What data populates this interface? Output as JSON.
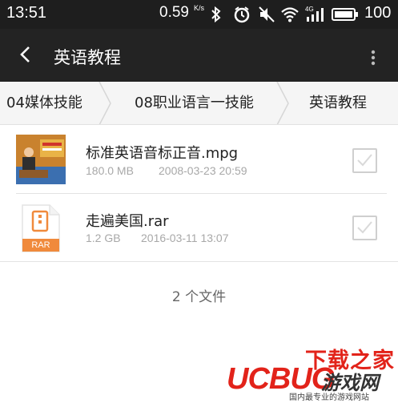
{
  "status_bar": {
    "time": "13:51",
    "net_speed": "0.59",
    "net_speed_unit": "K/s",
    "battery": "100",
    "icons": [
      "bluetooth-icon",
      "alarm-icon",
      "mute-icon",
      "wifi-icon",
      "signal-4g-icon",
      "battery-icon"
    ]
  },
  "app_bar": {
    "title": "英语教程"
  },
  "breadcrumb": {
    "items": [
      "04媒体技能",
      "08职业语言一技能",
      "英语教程"
    ]
  },
  "files": [
    {
      "name": "标准英语音标正音.mpg",
      "size": "180.0 MB",
      "date": "2008-03-23 20:59",
      "icon": "video-thumbnail-icon"
    },
    {
      "name": "走遍美国.rar",
      "size": "1.2 GB",
      "date": "2016-03-11 13:07",
      "icon": "rar-archive-icon",
      "badge": "RAR"
    }
  ],
  "footer": {
    "file_count": "2 个文件"
  },
  "watermark": {
    "top": "下载之家",
    "brand": "UCBUG",
    "brand_sub": "游戏网",
    "bottom": "国内最专业的游戏网站"
  },
  "colors": {
    "status_bar": "#1e1e1e",
    "app_bar": "#232323",
    "breadcrumb_bg": "#f5f5f5",
    "rar_orange": "#f08a3c",
    "watermark_red": "#e2231a"
  }
}
